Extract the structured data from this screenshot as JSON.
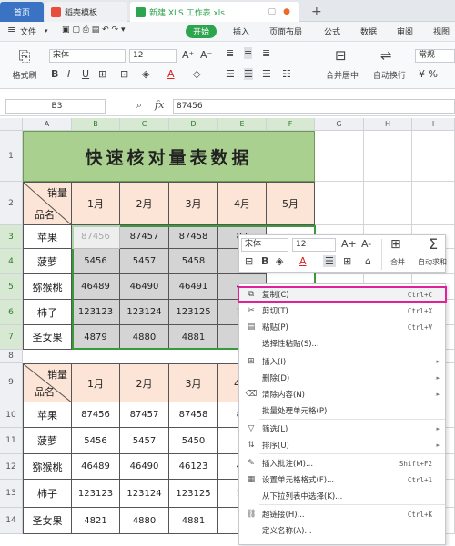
{
  "tabs": {
    "home": "首页",
    "template": "稻壳模板",
    "file": "新建 XLS 工作表.xls",
    "new": "+"
  },
  "menubar": {
    "hamburger": "≡",
    "file": "文件",
    "start": "开始",
    "insert": "插入",
    "layout": "页面布局",
    "formula": "公式",
    "data": "数据",
    "review": "审阅",
    "view": "视图"
  },
  "ribbon": {
    "format_brush": "格式刷",
    "font_name": "宋体",
    "font_size": "12",
    "merge": "合并居中",
    "wrap": "自动换行",
    "number_format": "常规"
  },
  "formula_bar": {
    "cell_ref": "B3",
    "fx": "fx",
    "value": "87456"
  },
  "columns": [
    "A",
    "B",
    "C",
    "D",
    "E",
    "F",
    "G",
    "H",
    "I"
  ],
  "rows": [
    "1",
    "2",
    "3",
    "4",
    "5",
    "6",
    "7",
    "8",
    "9",
    "10",
    "11",
    "12",
    "13",
    "14"
  ],
  "sheet": {
    "title": "快速核对量表数据",
    "header_top": "销量",
    "header_bottom": "品名",
    "months": [
      "1月",
      "2月",
      "3月",
      "4月",
      "5月"
    ],
    "table1": [
      {
        "name": "苹果",
        "v": [
          "87456",
          "87457",
          "87458",
          "87"
        ]
      },
      {
        "name": "菠萝",
        "v": [
          "5456",
          "5457",
          "5458",
          "5"
        ]
      },
      {
        "name": "猕猴桃",
        "v": [
          "46489",
          "46490",
          "46491",
          "46"
        ]
      },
      {
        "name": "柿子",
        "v": [
          "123123",
          "123124",
          "123125",
          "12"
        ]
      },
      {
        "name": "圣女果",
        "v": [
          "4879",
          "4880",
          "4881",
          "4"
        ]
      }
    ],
    "months2": [
      "1月",
      "2月",
      "3月",
      "4月"
    ],
    "table2": [
      {
        "name": "苹果",
        "v": [
          "87456",
          "87457",
          "87458",
          "87"
        ]
      },
      {
        "name": "菠萝",
        "v": [
          "5456",
          "5457",
          "5450",
          "5"
        ]
      },
      {
        "name": "猕猴桃",
        "v": [
          "46489",
          "46490",
          "46123",
          "46"
        ]
      },
      {
        "name": "柿子",
        "v": [
          "123123",
          "123124",
          "123125",
          "12"
        ]
      },
      {
        "name": "圣女果",
        "v": [
          "4821",
          "4880",
          "4881",
          "4"
        ]
      }
    ]
  },
  "mini_toolbar": {
    "font": "宋体",
    "size": "12",
    "grow": "A+",
    "shrink": "A-",
    "merge": "合并",
    "autosum": "自动求和"
  },
  "context_menu": [
    {
      "icon": "⧉",
      "label": "复制(C)",
      "shortcut": "Ctrl+C"
    },
    {
      "icon": "✂",
      "label": "剪切(T)",
      "shortcut": "Ctrl+X"
    },
    {
      "icon": "▤",
      "label": "粘贴(P)",
      "shortcut": "Ctrl+V"
    },
    {
      "icon": "",
      "label": "选择性粘贴(S)...",
      "shortcut": ""
    },
    {
      "icon": "⊞",
      "label": "插入(I)",
      "shortcut": ""
    },
    {
      "icon": "",
      "label": "删除(D)",
      "shortcut": ""
    },
    {
      "icon": "⌫",
      "label": "清除内容(N)",
      "shortcut": ""
    },
    {
      "icon": "",
      "label": "批量处理单元格(P)",
      "shortcut": ""
    },
    {
      "icon": "▽",
      "label": "筛选(L)",
      "shortcut": ""
    },
    {
      "icon": "⇅",
      "label": "排序(U)",
      "shortcut": ""
    },
    {
      "icon": "✎",
      "label": "插入批注(M)...",
      "shortcut": "Shift+F2"
    },
    {
      "icon": "▦",
      "label": "设置单元格格式(F)...",
      "shortcut": "Ctrl+1"
    },
    {
      "icon": "",
      "label": "从下拉列表中选择(K)...",
      "shortcut": ""
    },
    {
      "icon": "⛓",
      "label": "超链接(H)...",
      "shortcut": "Ctrl+K"
    },
    {
      "icon": "",
      "label": "定义名称(A)...",
      "shortcut": ""
    }
  ],
  "colors": {
    "title_bg": "#a9d08e",
    "header_bg": "#fce4d6",
    "selection_border": "#3a9a3a",
    "highlight": "#e0219a",
    "start_btn": "#2da44e"
  }
}
